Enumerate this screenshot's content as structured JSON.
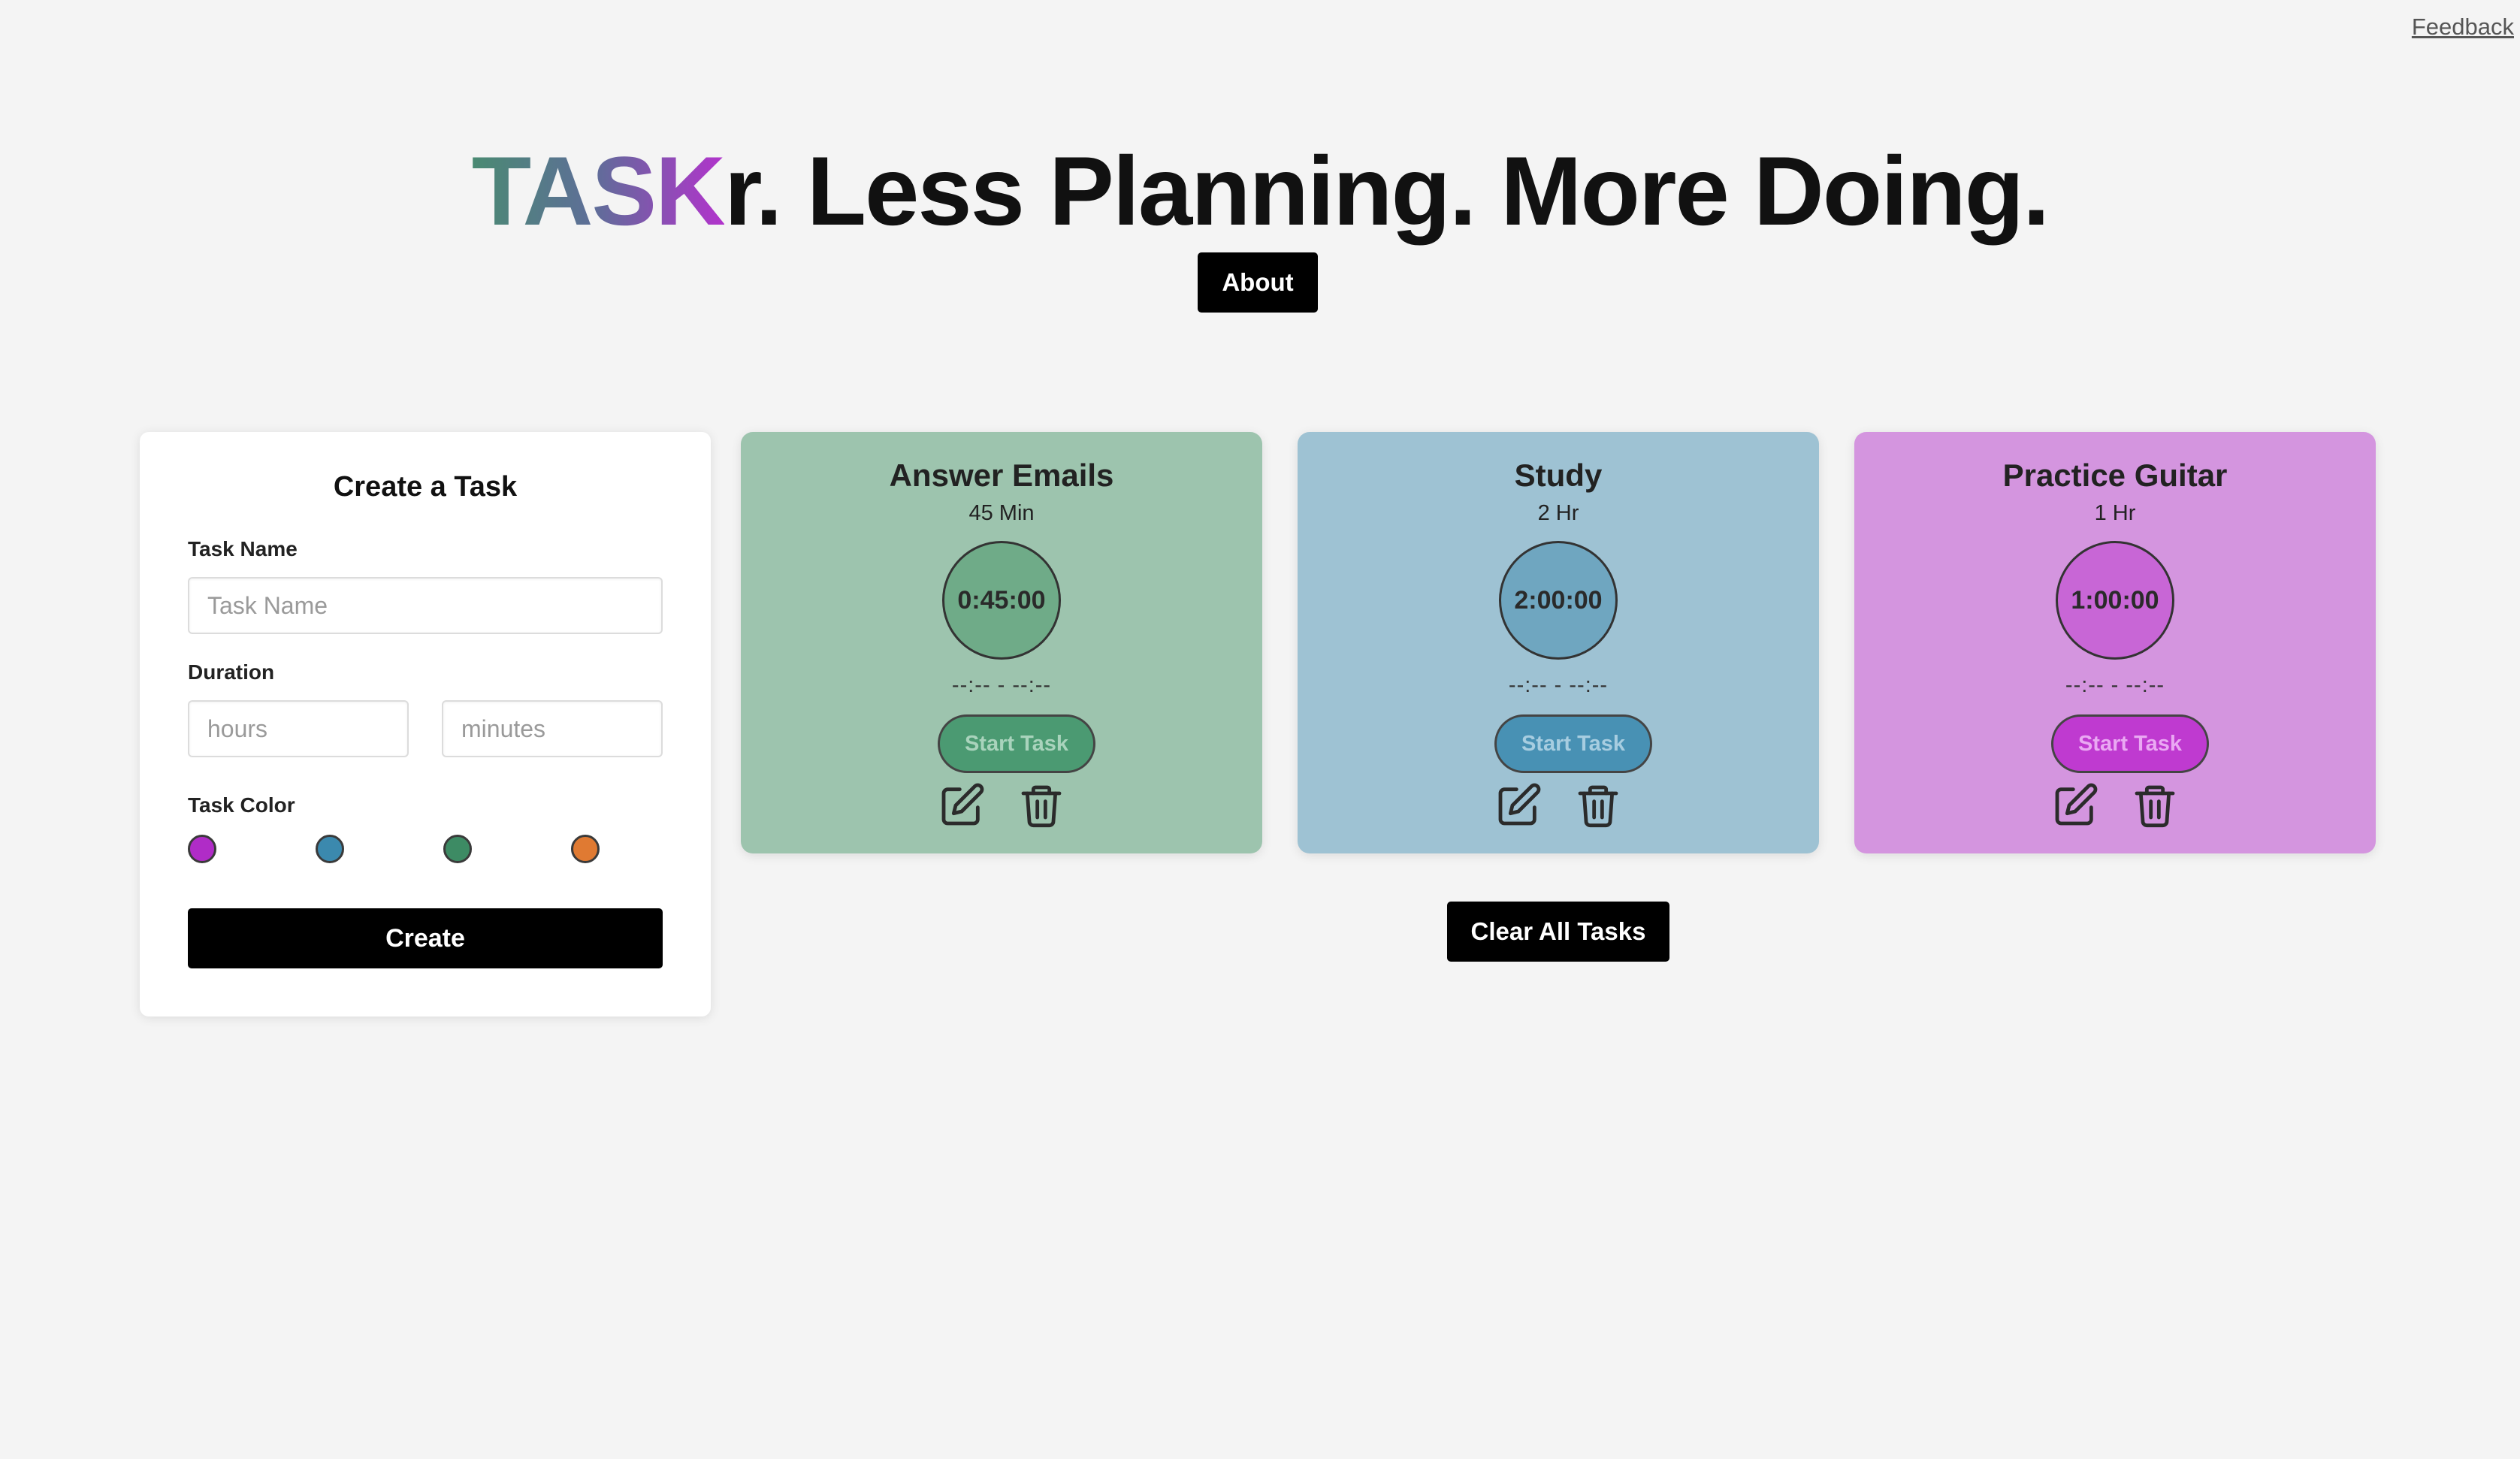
{
  "header": {
    "feedback_label": "Feedback",
    "brand": "TASK",
    "title_rest": "r. Less Planning. More Doing.",
    "about_label": "About"
  },
  "create_form": {
    "title": "Create a Task",
    "task_name_label": "Task Name",
    "task_name_placeholder": "Task Name",
    "task_name_value": "",
    "duration_label": "Duration",
    "hours_placeholder": "hours",
    "minutes_placeholder": "minutes",
    "color_label": "Task Color",
    "colors": [
      "#b02cc7",
      "#3b89ae",
      "#3d8b64",
      "#e07a32"
    ],
    "create_label": "Create"
  },
  "tasks": [
    {
      "title": "Answer Emails",
      "duration": "45 Min",
      "timer": "0:45:00",
      "time_range": "--:-- - --:--",
      "start_label": "Start Task",
      "card_color": "#9dc4ae",
      "circle_color": "#6fab88",
      "button_bg": "#4b9a72",
      "button_text_color": "#a9d3bc"
    },
    {
      "title": "Study",
      "duration": "2 Hr",
      "timer": "2:00:00",
      "time_range": "--:-- - --:--",
      "start_label": "Start Task",
      "card_color": "#9ec2d3",
      "circle_color": "#6fa6c0",
      "button_bg": "#4891b4",
      "button_text_color": "#a7cde0"
    },
    {
      "title": "Practice Guitar",
      "duration": "1 Hr",
      "timer": "1:00:00",
      "time_range": "--:-- - --:--",
      "start_label": "Start Task",
      "card_color": "#d495df",
      "circle_color": "#c866d6",
      "button_bg": "#bf3ad0",
      "button_text_color": "#eaa9f3"
    }
  ],
  "clear_label": "Clear All Tasks"
}
